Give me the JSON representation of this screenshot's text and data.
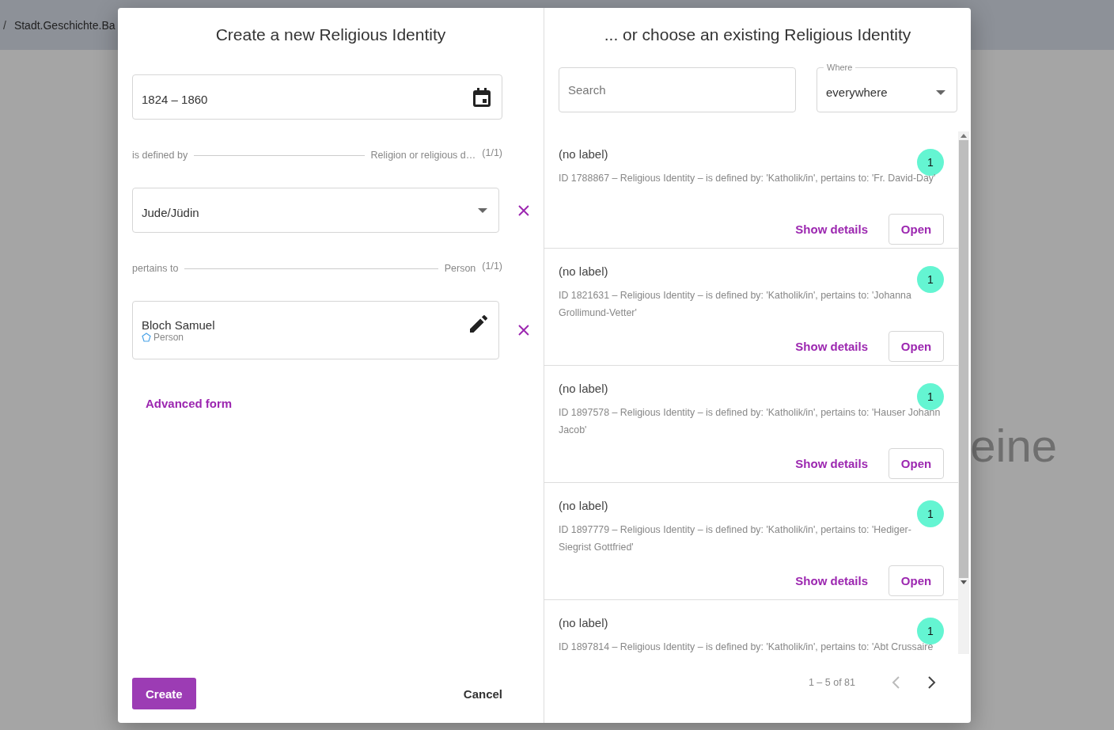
{
  "background": {
    "breadcrumb_separator": "/",
    "breadcrumb": "Stadt.Geschichte.Ba",
    "heading_right": "eine"
  },
  "create_panel": {
    "title": "Create a new Religious Identity",
    "date_field": {
      "value": "1824 – 1860"
    },
    "sections": [
      {
        "label": "is defined by",
        "target": "Religion or religious d…",
        "count": "(1/1)",
        "field": {
          "kind": "select",
          "value": "Jude/Jüdin"
        }
      },
      {
        "label": "pertains to",
        "target": "Person",
        "count": "(1/1)",
        "field": {
          "kind": "entity",
          "value": "Bloch Samuel",
          "type": "Person"
        }
      }
    ],
    "advanced_link": "Advanced form",
    "create_button": "Create",
    "cancel_button": "Cancel"
  },
  "choose_panel": {
    "title": "... or choose an existing Religious Identity",
    "search": {
      "placeholder": "Search"
    },
    "where": {
      "label": "Where",
      "value": "everywhere"
    },
    "results": [
      {
        "label": "(no label)",
        "count": "1",
        "description": "ID 1788867 – Religious Identity – is defined by: 'Katholik/in', pertains to: 'Fr. David-Day'",
        "details": "Show details",
        "open": "Open"
      },
      {
        "label": "(no label)",
        "count": "1",
        "description": "ID 1821631 – Religious Identity – is defined by: 'Katholik/in', pertains to: 'Johanna Grollimund-Vetter'",
        "details": "Show details",
        "open": "Open"
      },
      {
        "label": "(no label)",
        "count": "1",
        "description": "ID 1897578 – Religious Identity – is defined by: 'Katholik/in', pertains to: 'Hauser Johann Jacob'",
        "details": "Show details",
        "open": "Open"
      },
      {
        "label": "(no label)",
        "count": "1",
        "description": "ID 1897779 – Religious Identity – is defined by: 'Katholik/in', pertains to: 'Hediger-Siegrist Gottfried'",
        "details": "Show details",
        "open": "Open"
      },
      {
        "label": "(no label)",
        "count": "1",
        "description": "ID 1897814 – Religious Identity – is defined by: 'Katholik/in', pertains to: 'Abt Crussaire"
      }
    ],
    "pagination": {
      "range": "1 – 5 of 81",
      "previous_disabled": true,
      "next_disabled": false
    }
  }
}
